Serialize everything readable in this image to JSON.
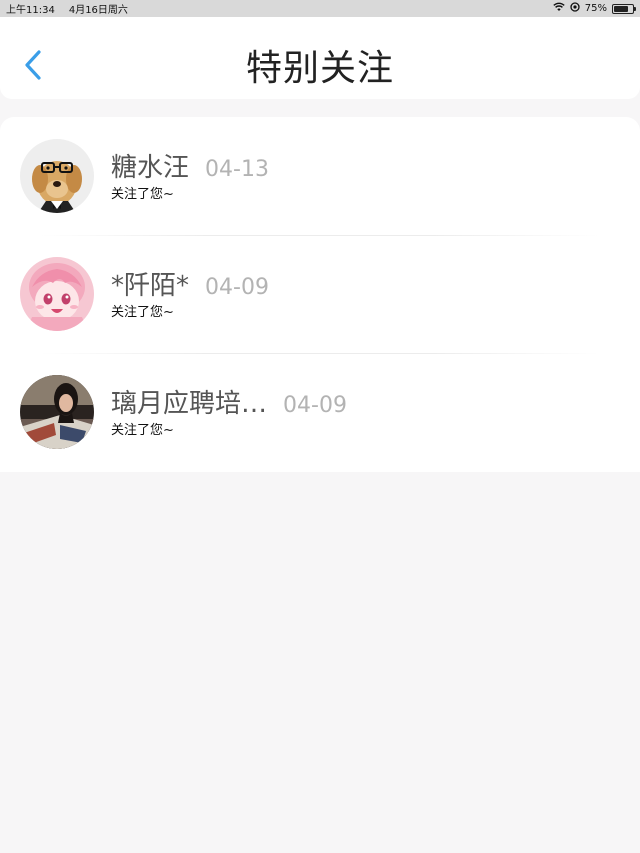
{
  "status_bar": {
    "time": "上午11:34",
    "date": "4月16日周六",
    "battery": "75%",
    "battery_level": 0.75,
    "icons": [
      "wifi-icon",
      "location-icon",
      "battery-icon"
    ]
  },
  "header": {
    "title": "特别关注",
    "back_icon": "chevron-left-icon",
    "accent_color": "#3a9ee8"
  },
  "list": {
    "items": [
      {
        "name": "糖水汪",
        "date": "04-13",
        "subtitle": "关注了您~",
        "avatar": "avatar-dog"
      },
      {
        "name": "*阡陌*",
        "date": "04-09",
        "subtitle": "关注了您~",
        "avatar": "avatar-anime"
      },
      {
        "name": "璃月应聘培…",
        "date": "04-09",
        "subtitle": "关注了您~",
        "avatar": "avatar-photo"
      }
    ]
  }
}
